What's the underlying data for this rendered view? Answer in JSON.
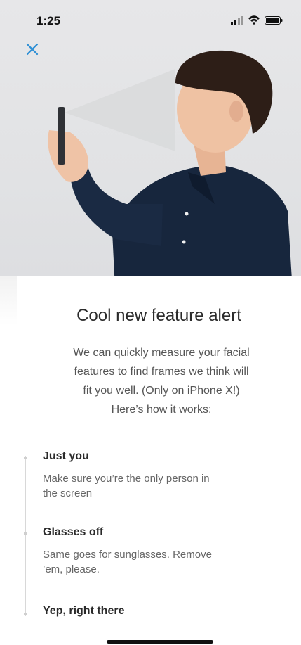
{
  "status_bar": {
    "time": "1:25",
    "icons": [
      "signal-icon",
      "wifi-icon",
      "battery-icon"
    ]
  },
  "header": {
    "close_icon": "close-icon",
    "accent_color": "#2d8fd5"
  },
  "hero": {
    "image": "man-holding-phone-to-face-photo"
  },
  "card": {
    "title": "Cool new feature alert",
    "intro_lines": [
      "We can quickly measure your facial",
      "features to find frames we think will",
      "fit you well. (Only on iPhone X!)",
      "Here’s how it works:"
    ]
  },
  "steps": [
    {
      "title": "Just you",
      "description_lines": [
        "Make sure you’re the only person in",
        "the screen"
      ]
    },
    {
      "title": "Glasses off",
      "description_lines": [
        "Same goes for sunglasses. Remove",
        "’em, please."
      ]
    },
    {
      "title": "Yep, right there",
      "description_lines": []
    }
  ]
}
